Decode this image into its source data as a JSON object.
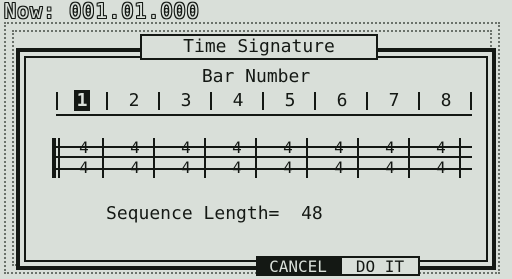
{
  "header": {
    "now_label": "Now: 001.01.000"
  },
  "dialog": {
    "title": "Time Signature",
    "bar_number_label": "Bar Number",
    "bars": [
      "1",
      "2",
      "3",
      "4",
      "5",
      "6",
      "7",
      "8"
    ],
    "selected_bar_index": 0,
    "time_signatures": [
      {
        "numerator": "4",
        "denominator": "4"
      },
      {
        "numerator": "4",
        "denominator": "4"
      },
      {
        "numerator": "4",
        "denominator": "4"
      },
      {
        "numerator": "4",
        "denominator": "4"
      },
      {
        "numerator": "4",
        "denominator": "4"
      },
      {
        "numerator": "4",
        "denominator": "4"
      },
      {
        "numerator": "4",
        "denominator": "4"
      },
      {
        "numerator": "4",
        "denominator": "4"
      }
    ],
    "sequence_length_label": "Sequence Length=",
    "sequence_length_value": "48"
  },
  "softkeys": {
    "cancel": "CANCEL",
    "do_it": "DO IT"
  },
  "colors": {
    "lcd_background": "#d9dfd9",
    "ink": "#141814"
  }
}
